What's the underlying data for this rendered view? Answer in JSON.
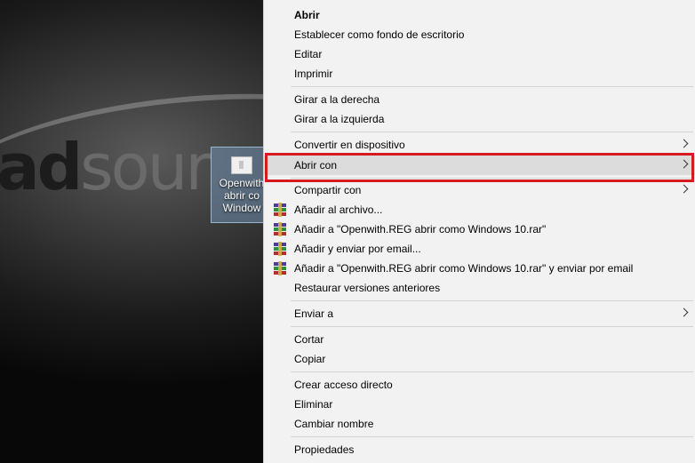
{
  "desktop": {
    "wallpaper_text_dark": "ad",
    "wallpaper_text_light": "sour",
    "icon": {
      "label_line1": "Openwith",
      "label_line2": "abrir co",
      "label_line3": "Window"
    }
  },
  "menu": {
    "items": [
      {
        "label": "Abrir"
      },
      {
        "label": "Establecer como fondo de escritorio"
      },
      {
        "label": "Editar"
      },
      {
        "label": "Imprimir"
      },
      {
        "label": "Girar a la derecha"
      },
      {
        "label": "Girar a la izquierda"
      },
      {
        "label": "Convertir en dispositivo"
      },
      {
        "label": "Abrir con"
      },
      {
        "label": "Compartir con"
      },
      {
        "label": "Añadir al archivo..."
      },
      {
        "label": "Añadir a \"Openwith.REG abrir como Windows 10.rar\""
      },
      {
        "label": "Añadir y enviar por email..."
      },
      {
        "label": "Añadir a \"Openwith.REG abrir como Windows 10.rar\" y enviar por email"
      },
      {
        "label": "Restaurar versiones anteriores"
      },
      {
        "label": "Enviar a"
      },
      {
        "label": "Cortar"
      },
      {
        "label": "Copiar"
      },
      {
        "label": "Crear acceso directo"
      },
      {
        "label": "Eliminar"
      },
      {
        "label": "Cambiar nombre"
      },
      {
        "label": "Propiedades"
      }
    ],
    "highlighted_item": "Abrir con",
    "icon_names": {
      "rar": "winrar-archive-icon",
      "submenu": "chevron-right-icon"
    }
  },
  "colors": {
    "menu_background": "#f2f2f2",
    "highlight": "#dcdcdc",
    "annotation_box": "#d71920"
  }
}
